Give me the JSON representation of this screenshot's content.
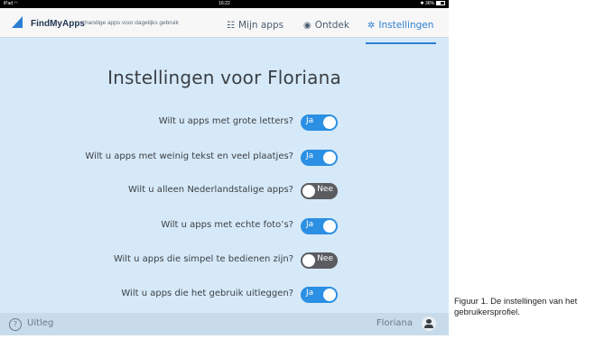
{
  "statusbar": {
    "device": "iPad",
    "wifi_icon": "wifi-icon",
    "time": "16:22",
    "bluetooth_icon": "bluetooth-icon",
    "battery": "36%"
  },
  "navbar": {
    "brand": "FindMyApps",
    "tagline": "handige apps voor dagelijks gebruik",
    "tabs": [
      {
        "label": "Mijn apps",
        "icon": "grid-icon",
        "active": false
      },
      {
        "label": "Ontdek",
        "icon": "compass-icon",
        "active": false
      },
      {
        "label": "Instellingen",
        "icon": "gear-icon",
        "active": true
      }
    ]
  },
  "page": {
    "title": "Instellingen voor Floriana"
  },
  "settings": [
    {
      "question": "Wilt u apps met grote letters?",
      "value": "Ja",
      "on": true
    },
    {
      "question": "Wilt u apps met weinig tekst en veel plaatjes?",
      "value": "Ja",
      "on": true
    },
    {
      "question": "Wilt u alleen Nederlandstalige apps?",
      "value": "Nee",
      "on": false
    },
    {
      "question": "Wilt u apps met echte foto’s?",
      "value": "Ja",
      "on": true
    },
    {
      "question": "Wilt u apps die simpel te bedienen zijn?",
      "value": "Nee",
      "on": false
    },
    {
      "question": "Wilt u apps die het gebruik uitleggen?",
      "value": "Ja",
      "on": true
    }
  ],
  "bottombar": {
    "help_label": "Uitleg",
    "user_name": "Floriana"
  },
  "caption": "Figuur 1. De instellingen van het gebruikersprofiel.",
  "colors": {
    "accent": "#2b8fe3",
    "background": "#d6e9f8",
    "toggle_off": "#5a5c60"
  }
}
